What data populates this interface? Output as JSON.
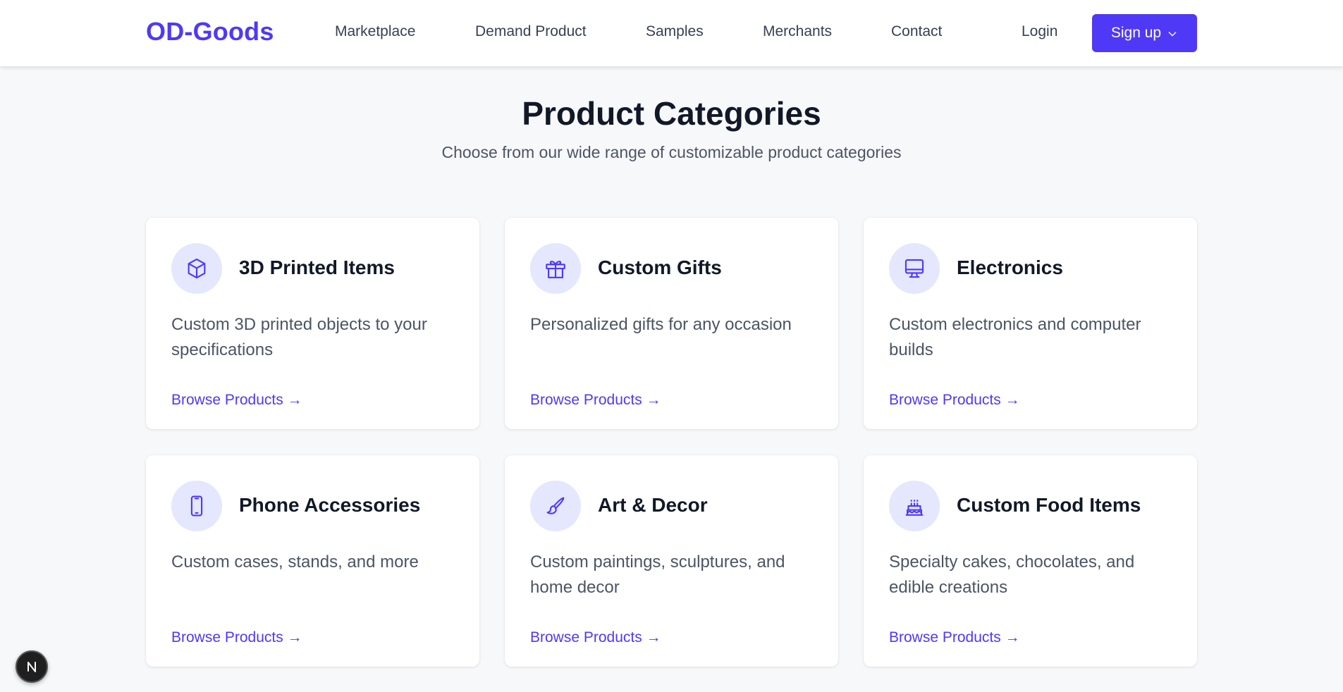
{
  "brand": {
    "logo": "OD-Goods",
    "accent_color": "#4f39f6"
  },
  "nav": {
    "links": [
      "Marketplace",
      "Demand Product",
      "Samples",
      "Merchants",
      "Contact"
    ],
    "login": "Login",
    "signup": "Sign up",
    "signup_icon": "chevron-down-icon"
  },
  "hero": {
    "title": "Product Categories",
    "subtitle": "Choose from our wide range of customizable product categories"
  },
  "categories": [
    {
      "icon": "cube-icon",
      "title": "3D Printed Items",
      "description": "Custom 3D printed objects to your specifications",
      "link": "Browse Products →"
    },
    {
      "icon": "gift-icon",
      "title": "Custom Gifts",
      "description": "Personalized gifts for any occasion",
      "link": "Browse Products →"
    },
    {
      "icon": "computer-icon",
      "title": "Electronics",
      "description": "Custom electronics and computer builds",
      "link": "Browse Products →"
    },
    {
      "icon": "phone-icon",
      "title": "Phone Accessories",
      "description": "Custom cases, stands, and more",
      "link": "Browse Products →"
    },
    {
      "icon": "paintbrush-icon",
      "title": "Art & Decor",
      "description": "Custom paintings, sculptures, and home decor",
      "link": "Browse Products →"
    },
    {
      "icon": "cake-icon",
      "title": "Custom Food Items",
      "description": "Specialty cakes, chocolates, and edible creations",
      "link": "Browse Products →"
    }
  ],
  "dev_badge": {
    "label": "N",
    "icon": "nextjs-icon"
  }
}
